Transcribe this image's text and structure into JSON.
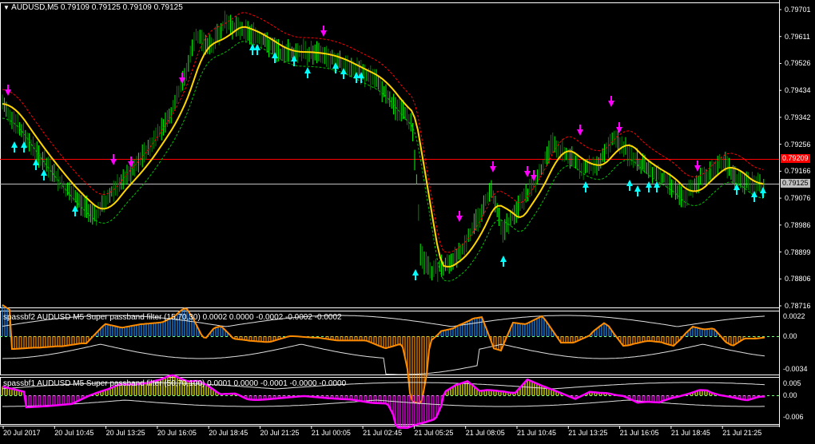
{
  "main_chart": {
    "title": "AUDUSD,M5  0.79109 0.79125 0.79109 0.79125",
    "title_arrow": "▼",
    "price_labels": [
      "0.79701",
      "0.79611",
      "0.79526",
      "0.79434",
      "0.79342",
      "0.79256",
      "0.79166",
      "0.79076",
      "0.78986",
      "0.78899",
      "0.78806",
      "0.78716"
    ],
    "red_line_price": "0.79209",
    "grey_line_price": "0.79125",
    "red_line_color": "#ff0000",
    "grey_line_color": "#c0c0c0"
  },
  "indicator1": {
    "title": "spassbf2 AUDUSD M5 Super passband filter (15,70,30) 0.0002 0.0000 -0.0002 -0.0002 -0.0002",
    "labels": [
      "0.0022",
      "0.00",
      "-0.0034"
    ]
  },
  "indicator2": {
    "title": "spassbf1 AUDUSD M5 Super passband filter (50,70,100) 0.0001 0.0000 -0.0001 -0.0000 -0.0000",
    "labels": [
      "0.005",
      "0.00",
      "-0.006"
    ]
  },
  "time_axis": {
    "labels": [
      "20 Jul 2017",
      "20 Jul 10:45",
      "20 Jul 13:25",
      "20 Jul 16:05",
      "20 Jul 18:45",
      "20 Jul 21:25",
      "21 Jul 00:05",
      "21 Jul 02:45",
      "21 Jul 05:25",
      "21 Jul 08:05",
      "21 Jul 10:45",
      "21 Jul 13:25",
      "21 Jul 16:05",
      "21 Jul 18:45",
      "21 Jul 21:25"
    ]
  },
  "colors": {
    "bullish_bar": "#00ff00",
    "bearish_bar": "#008000",
    "ma_line": "#ffd700",
    "band": "#ff0000",
    "band_lower": "#00c000",
    "up_arrow": "#00ffff",
    "down_arrow": "#ff00ff",
    "ind1_up": "#1e90ff",
    "ind1_down": "#ff8c00",
    "ind2_up": "#ffff00",
    "ind2_down": "#ff00ff"
  }
}
